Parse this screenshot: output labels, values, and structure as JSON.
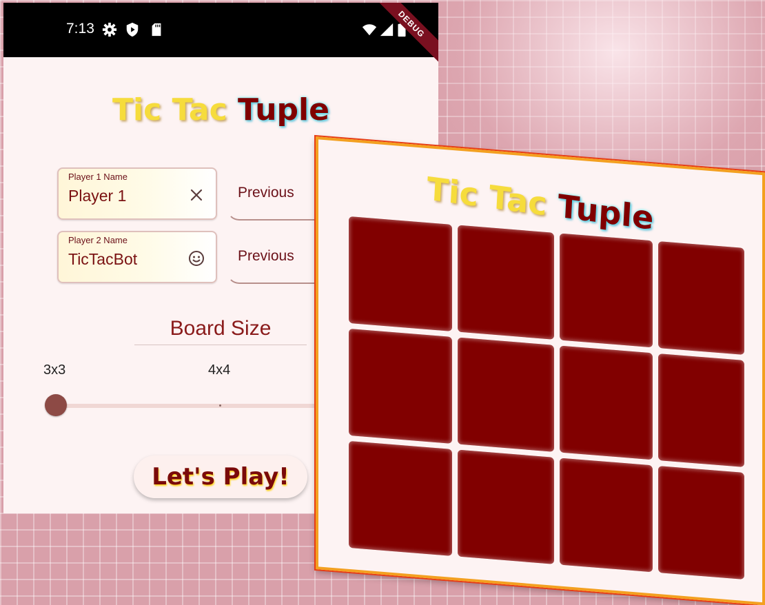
{
  "status_bar": {
    "time": "7:13",
    "icons": [
      "settings-icon",
      "play-protect-icon",
      "sd-card-icon",
      "wifi-icon",
      "signal-icon",
      "battery-icon"
    ],
    "debug_label": "DEBUG"
  },
  "app": {
    "title_words": [
      "Tic",
      "Tac",
      "Tuple"
    ],
    "player1": {
      "label": "Player 1 Name",
      "value": "Player 1",
      "icon": "close-icon"
    },
    "player2": {
      "label": "Player 2 Name",
      "value": "TicTacBot",
      "icon": "smiley-icon"
    },
    "previous_label": "Previous",
    "board_size_label": "Board Size",
    "board_sizes": [
      "3x3",
      "4x4"
    ],
    "selected_board_size": "3x3",
    "play_label": "Let's Play!"
  },
  "game_card": {
    "title_words": [
      "Tic",
      "Tac",
      "Tuple"
    ],
    "rows": 3,
    "columns": 4
  },
  "colors": {
    "accent": "#800000",
    "title_yellow": "#f6dc3c",
    "background_pink": "#d9a0aa"
  }
}
